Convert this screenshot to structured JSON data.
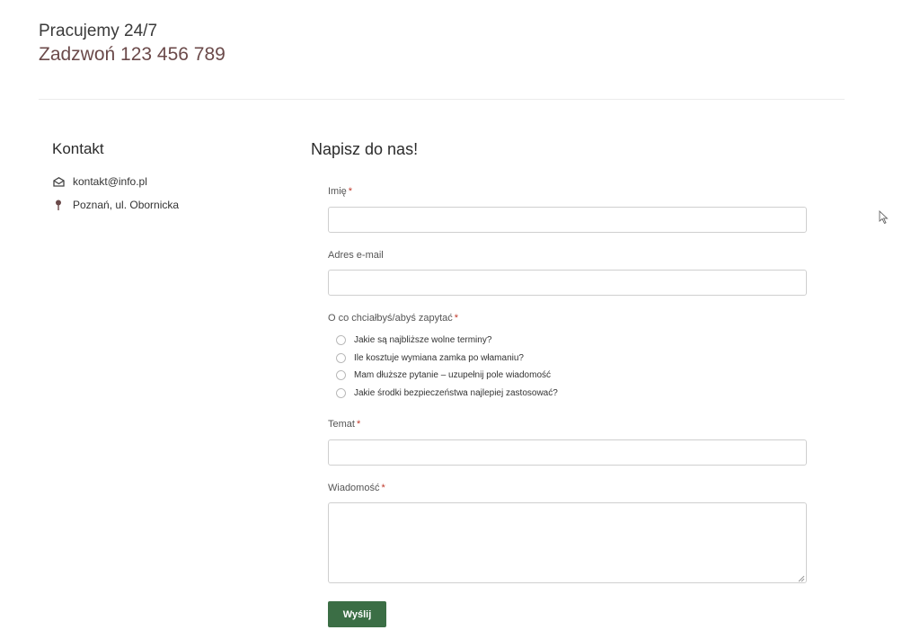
{
  "header": {
    "hours": "Pracujemy 24/7",
    "phone": "Zadzwoń 123 456 789"
  },
  "contact": {
    "title": "Kontakt",
    "email": "kontakt@info.pl",
    "email_icon": "envelope-icon",
    "address": "Poznań, ul. Obornicka",
    "address_icon": "map-pin-icon"
  },
  "form": {
    "title": "Napisz do nas!",
    "required_mark": "*",
    "name_label": "Imię",
    "name_value": "",
    "email_label": "Adres e-mail",
    "email_value": "",
    "question_label": "O co chciałbyś/abyś zapytać",
    "options": [
      "Jakie są najbliższe wolne terminy?",
      "Ile kosztuje wymiana zamka po włamaniu?",
      "Mam dłuższe pytanie – uzupełnij pole wiadomość",
      "Jakie środki bezpieczeństwa najlepiej zastosować?"
    ],
    "subject_label": "Temat",
    "subject_value": "",
    "message_label": "Wiadomość",
    "message_value": "",
    "submit_label": "Wyślij"
  },
  "colors": {
    "accent": "#3b6e45",
    "phone": "#6b4a4a",
    "required": "#c0392b"
  }
}
